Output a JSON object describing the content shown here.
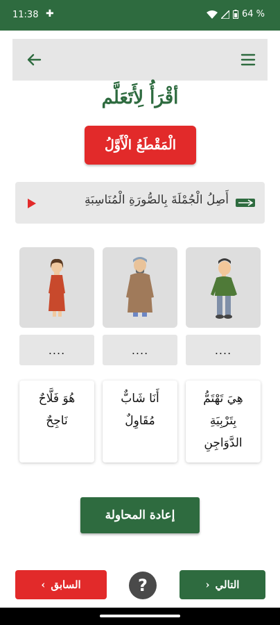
{
  "status_bar": {
    "time": "11:38",
    "battery": "64 %"
  },
  "page": {
    "title": "أقْرَأُ لِأَتَعَلَّم",
    "section_label": "الْمَقْطَعُ الْأَوَّلُ"
  },
  "instruction": {
    "text": "أَصِلُ الْجُمْلَةَ بِالصُّورَةِ الْمُنَاسِبَةِ"
  },
  "cards": [
    {
      "image": "boy-in-green-sweater",
      "slot": "...."
    },
    {
      "image": "man-in-robe",
      "slot": "...."
    },
    {
      "image": "girl-in-red-dress",
      "slot": "...."
    }
  ],
  "sentences": [
    {
      "lines": [
        "هِيَ تَهْتَمُّ",
        "بِتَرْبِيَةِ",
        "الدَّوَاجِنِ"
      ]
    },
    {
      "lines": [
        "أَنَا شَابٌّ",
        "مُقَاوِلٌ"
      ]
    },
    {
      "lines": [
        "هُوَ فَلَّاحٌ",
        "نَاجِحٌ"
      ]
    }
  ],
  "buttons": {
    "retry": "إعادة المحاولة",
    "previous": "السابق",
    "next": "التالي",
    "help": "?"
  },
  "colors": {
    "green": "#2e6b3f",
    "red": "#e22a2a"
  }
}
